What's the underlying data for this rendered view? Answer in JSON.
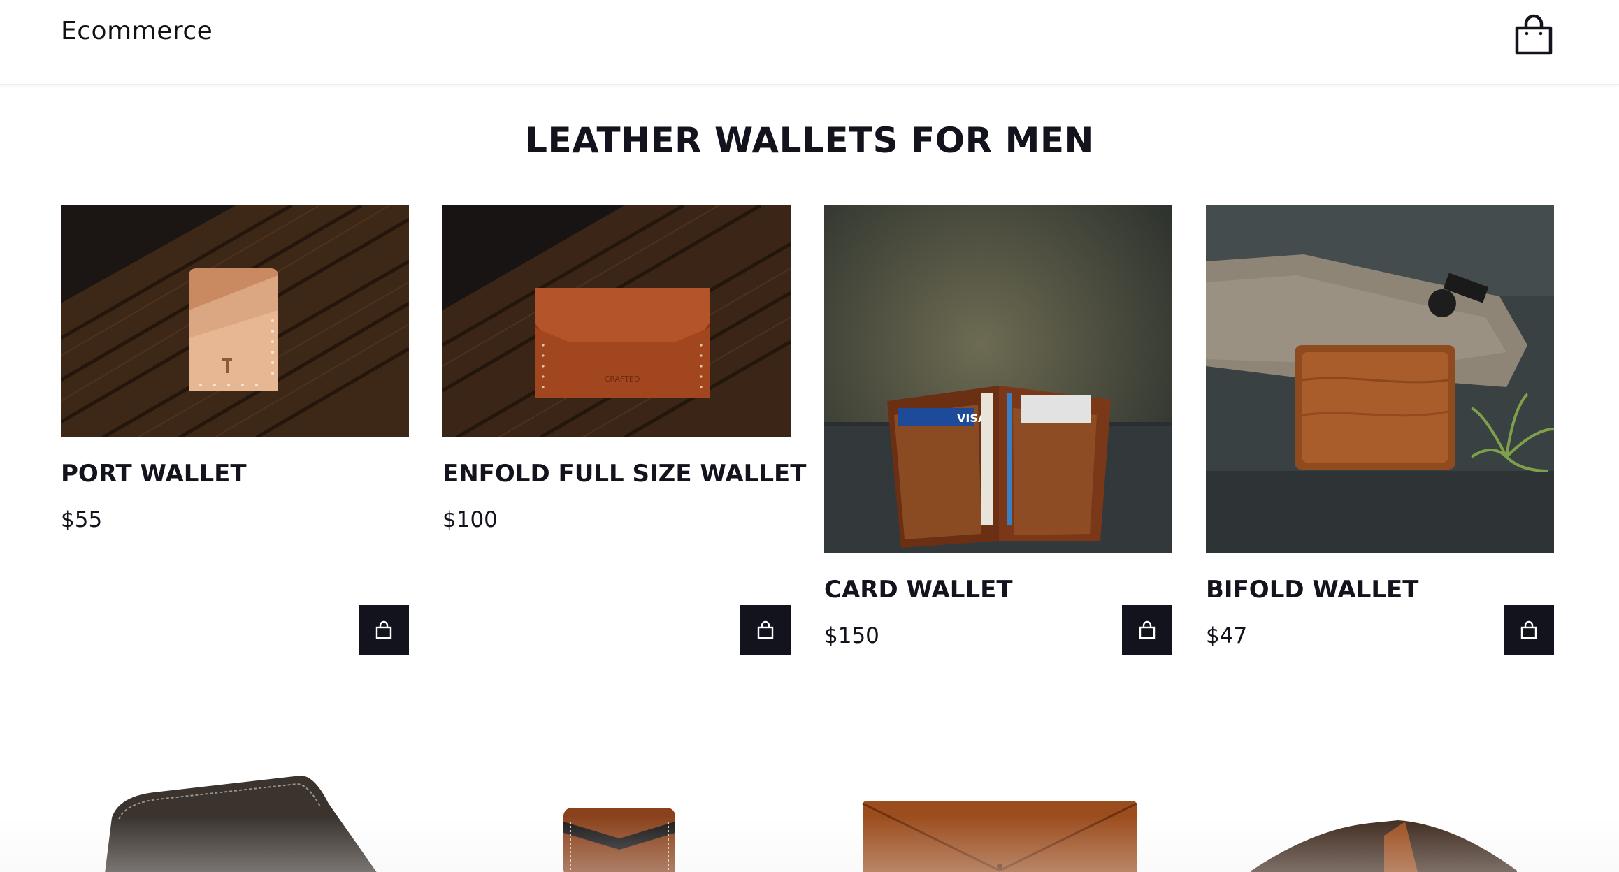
{
  "header": {
    "brand": "Ecommerce",
    "cart_icon": "shopping-bag-icon"
  },
  "page_title": "LEATHER WALLETS FOR MEN",
  "products": [
    {
      "name": "PORT WALLET",
      "price": "$55"
    },
    {
      "name": "ENFOLD FULL SIZE WALLET",
      "price": "$100"
    },
    {
      "name": "CARD WALLET",
      "price": "$150"
    },
    {
      "name": "BIFOLD WALLET",
      "price": "$47"
    }
  ],
  "add_to_cart_icon": "shopping-bag-icon",
  "colors": {
    "text": "#13131d",
    "button_bg": "#13131d",
    "button_icon": "#ffffff",
    "leather_tan": "#d9a07a",
    "leather_brown": "#a84d24",
    "wood_dark": "#3a2414"
  }
}
